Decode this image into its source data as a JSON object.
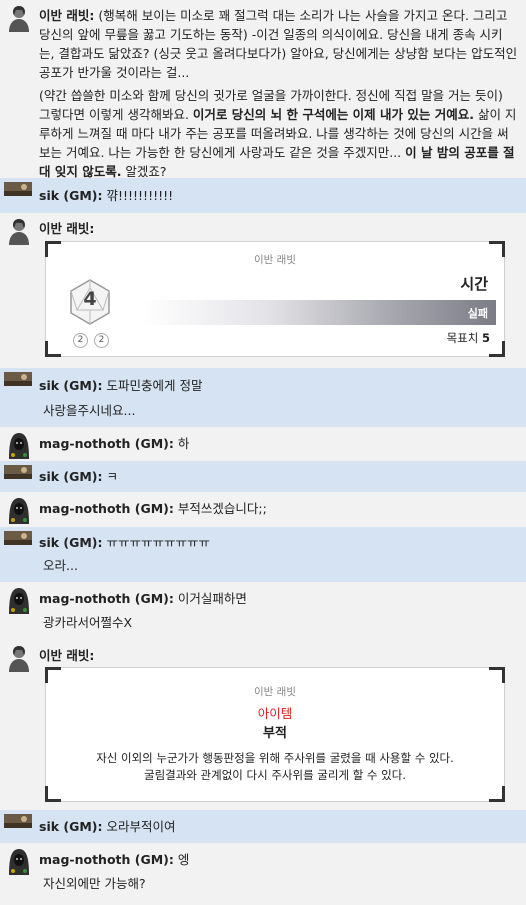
{
  "messages": [
    {
      "speaker": "이반 래빗:",
      "paragraphs": [
        [
          "(행복해 보이는 미소로 꽤 절그럭 대는 소리가 나는 사슬을 가지고 온다. 그리고 당신의 앞에 무릎을 꿇고 기도하는 동작) -이건 일종의 의식이에요. 당신을 내게 종속 시키는, 결합과도 닮았죠? (싱긋 웃고 올려다보다가) 알아요, 당신에게는 상냥함 보다는 압도적인 공포가 반가울 것이라는 걸..."
        ],
        [
          "(약간 씁쓸한 미소와 함께 당신의 귓가로 얼굴을 가까이한다. 정신에 직접 말을 거는 듯이) 그렇다면 이렇게 생각해봐요. ",
          "이거로 당신의 뇌 한 구석에는 이제 내가 있는 거예요.",
          " 삶이 지루하게 느껴질 때 마다 내가 주는 공포를 떠올려봐요. 나를 생각하는 것에 당신의 시간을 써보는 거예요. 나는 가능한 한 당신에게 사랑과도 같은 것을 주겠지만... ",
          "이 날 밤의 공포를 절대 잊지 않도록.",
          " 알겠죠?"
        ]
      ]
    },
    {
      "speaker": "sik (GM):",
      "lines": [
        "꺆!!!!!!!!!!!"
      ]
    },
    {
      "speaker": "이반 래빗:",
      "roll": {
        "character": "이반 래빗",
        "die_value": "4",
        "dice": [
          "2",
          "2"
        ],
        "skill": "시간",
        "result": "실패",
        "target_label": "목표치",
        "target_value": "5"
      }
    },
    {
      "speaker": "sik (GM):",
      "lines": [
        "도파민충에게 정말",
        "사랑을주시네요..."
      ]
    },
    {
      "speaker": "mag-nothoth (GM):",
      "lines": [
        "하"
      ]
    },
    {
      "speaker": "sik (GM):",
      "lines": [
        "ㅋ"
      ]
    },
    {
      "speaker": "mag-nothoth (GM):",
      "lines": [
        "부적쓰겠습니다;;"
      ]
    },
    {
      "speaker": "sik (GM):",
      "lines": [
        "ㅠㅠㅠㅠㅠㅠㅠㅠㅠ",
        "오라..."
      ]
    },
    {
      "speaker": "mag-nothoth (GM):",
      "lines": [
        "이거실패하면",
        "광카라서어쩔수X"
      ]
    },
    {
      "speaker": "이반 래빗:",
      "item": {
        "character": "이반 래빗",
        "type": "아이템",
        "name": "부적",
        "description_1": "자신 이외의 누군가가 행동판정을 위해 주사위를 굴렸을 때 사용할 수 있다.",
        "description_2": "굴림결과와 관계없이 다시 주사위를 굴리게 할 수 있다."
      }
    },
    {
      "speaker": "sik (GM):",
      "lines": [
        "오라부적이여"
      ]
    },
    {
      "speaker": "mag-nothoth (GM):",
      "lines": [
        "엥",
        "자신외에만 가능해?"
      ]
    }
  ],
  "colors": {
    "gm_bg": "#d5e3f2",
    "plain_bg": "#f2f2f2",
    "fail_red": "#e02020"
  },
  "icons": {
    "ivan": "character-portrait-icon",
    "sik": "landscape-avatar-icon",
    "mag": "hooded-figure-avatar-icon",
    "d20": "d20-die-icon"
  }
}
